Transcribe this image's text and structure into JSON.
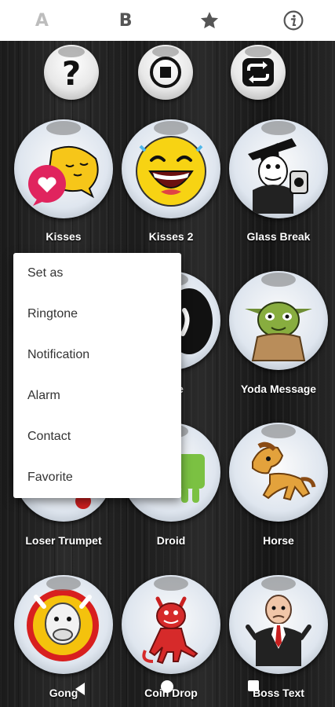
{
  "tabs": [
    {
      "label": "A",
      "active": true
    },
    {
      "label": "B",
      "active": false
    },
    {
      "icon": "star-icon"
    },
    {
      "icon": "info-icon"
    }
  ],
  "controls": [
    {
      "icon": "help-icon"
    },
    {
      "icon": "stop-icon"
    },
    {
      "icon": "repeat-icon"
    }
  ],
  "sounds": [
    {
      "label": "Kisses",
      "icon": "kissing-emoji-icon"
    },
    {
      "label": "Kisses 2",
      "icon": "laughing-emoji-icon"
    },
    {
      "label": "Glass Break",
      "icon": "cartoon-man-glass-icon"
    },
    {
      "label": "",
      "icon": "blue-face-icon"
    },
    {
      "label": "rture",
      "icon": "black-mask-icon"
    },
    {
      "label": "Yoda Message",
      "icon": "yoda-icon"
    },
    {
      "label": "Loser Trumpet",
      "icon": "trumpet-icon"
    },
    {
      "label": "Droid",
      "icon": "android-icon"
    },
    {
      "label": "Horse",
      "icon": "horse-icon"
    },
    {
      "label": "Gong",
      "icon": "bull-gong-icon"
    },
    {
      "label": "Coin Drop",
      "icon": "devil-icon"
    },
    {
      "label": "Boss Text",
      "icon": "boss-icon"
    }
  ],
  "menu": {
    "items": [
      "Set as",
      "Ringtone",
      "Notification",
      "Alarm",
      "Contact",
      "Favorite"
    ]
  },
  "colors": {
    "background": "#1c1c1c",
    "menu_bg": "#ffffff",
    "label": "#ffffff"
  }
}
